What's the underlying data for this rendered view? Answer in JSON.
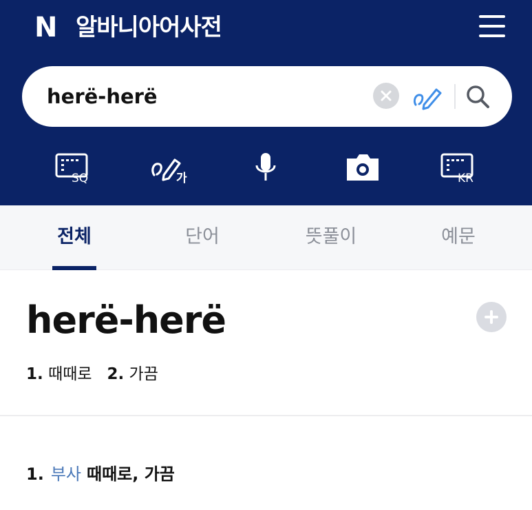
{
  "header": {
    "logo": "N",
    "title": "알바니아어사전"
  },
  "search": {
    "value": "herë-herë",
    "placeholder": ""
  },
  "icons": {
    "menu": "hamburger-menu-icon",
    "clear": "clear-icon",
    "handwriting": "handwriting-icon",
    "search": "search-icon",
    "albanian_keyboard": "keyboard-sq-icon",
    "korean_handwriting": "handwriting-korean-icon",
    "voice": "microphone-icon",
    "camera": "camera-icon",
    "korean_keyboard": "keyboard-kr-icon",
    "add": "add-icon"
  },
  "tools": {
    "albanian_keyboard_label": "SQ",
    "korean_handwriting_label": "가",
    "korean_keyboard_label": "KR"
  },
  "tabs": [
    {
      "label": "전체",
      "active": true
    },
    {
      "label": "단어",
      "active": false
    },
    {
      "label": "뜻풀이",
      "active": false
    },
    {
      "label": "예문",
      "active": false
    }
  ],
  "entry": {
    "headword": "herë-herë",
    "summary": [
      {
        "num": "1.",
        "text": "때때로"
      },
      {
        "num": "2.",
        "text": "가끔"
      }
    ],
    "senses": [
      {
        "num": "1.",
        "pos": "부사",
        "definition": "때때로, 가끔"
      }
    ]
  },
  "colors": {
    "header_bg": "#0b2366",
    "accent": "#0b2366",
    "pos_link": "#4a78b8",
    "handwriting_icon": "#3f8ee8"
  }
}
